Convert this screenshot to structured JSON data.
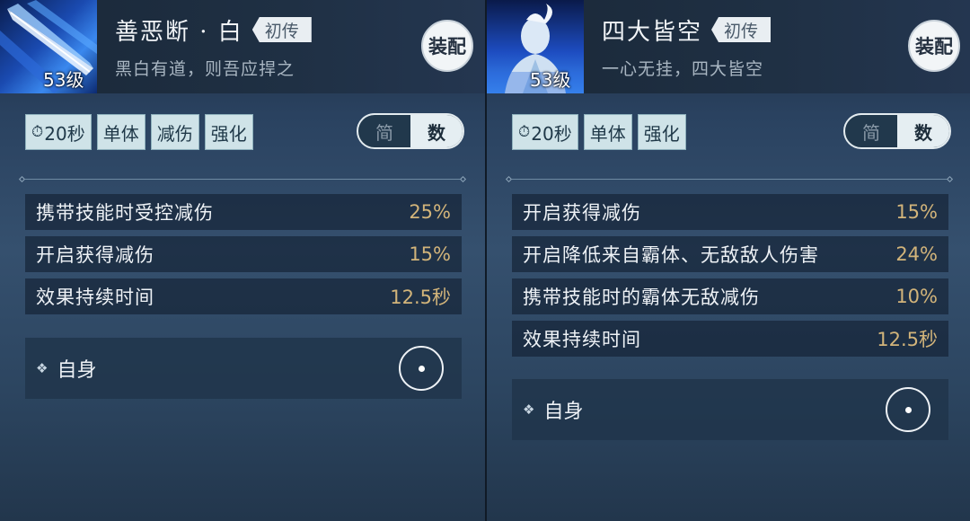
{
  "left": {
    "level": "53级",
    "name": "善恶断 · 白",
    "rank": "初传",
    "motto": "黑白有道，则吾应捍之",
    "equip": "装配",
    "tags": [
      "20秒",
      "单体",
      "减伤",
      "强化"
    ],
    "toggle": {
      "simple": "简",
      "numeric": "数",
      "selected": "数"
    },
    "stats": [
      {
        "label": "携带技能时受控减伤",
        "value": "25%"
      },
      {
        "label": "开启获得减伤",
        "value": "15%"
      },
      {
        "label": "效果持续时间",
        "value": "12.5秒"
      }
    ],
    "target": "自身"
  },
  "right": {
    "level": "53级",
    "name": "四大皆空",
    "rank": "初传",
    "motto": "一心无挂，四大皆空",
    "equip": "装配",
    "tags": [
      "20秒",
      "单体",
      "强化"
    ],
    "toggle": {
      "simple": "简",
      "numeric": "数",
      "selected": "数"
    },
    "stats": [
      {
        "label": "开启获得减伤",
        "value": "15%"
      },
      {
        "label": "开启降低来自霸体、无敌敌人伤害",
        "value": "24%"
      },
      {
        "label": "携带技能时的霸体无敌减伤",
        "value": "10%"
      },
      {
        "label": "效果持续时间",
        "value": "12.5秒"
      }
    ],
    "target": "自身"
  }
}
